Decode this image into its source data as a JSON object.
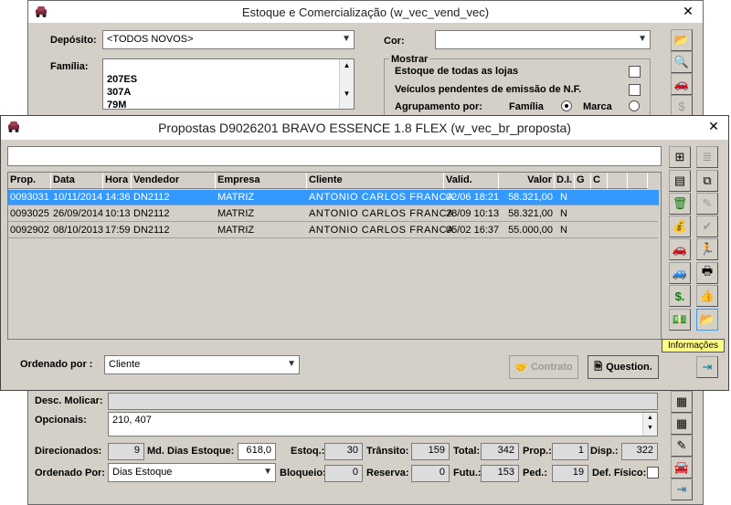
{
  "back_window": {
    "title": "Estoque e Comercialização (w_vec_vend_vec)",
    "deposito_label": "Depósito:",
    "deposito_value": "<TODOS NOVOS>",
    "cor_label": "Cor:",
    "cor_value": "",
    "familia_label": "Família:",
    "familia_items": [
      "207ES",
      "307A",
      "79M"
    ],
    "mostrar_label": "Mostrar",
    "estoque_lojas_label": "Estoque de todas as lojas",
    "veiculos_pendentes_label": "Veículos pendentes de emissão de N.F.",
    "agrupamento_label": "Agrupamento por:",
    "familia_radio_label": "Família",
    "marca_radio_label": "Marca",
    "desc_molicar_label": "Desc. Molicar:",
    "desc_molicar_value": "",
    "opcionais_label": "Opcionais:",
    "opcionais_value": "210, 407",
    "direcionados_label": "Direcionados:",
    "direcionados_value": "9",
    "md_dias_label": "Md. Dias Estoque:",
    "md_dias_value": "618,0",
    "estoq_label": "Estoq.:",
    "estoq_value": "30",
    "transito_label": "Trânsito:",
    "transito_value": "159",
    "total_label": "Total:",
    "total_value": "342",
    "prop_label": "Prop.:",
    "prop_value": "1",
    "disp_label": "Disp.:",
    "disp_value": "322",
    "ordenado_label": "Ordenado Por:",
    "ordenado_value": "Dias Estoque",
    "bloqueio_label": "Bloqueio:",
    "bloqueio_value": "0",
    "reserva_label": "Reserva:",
    "reserva_value": "0",
    "futu_label": "Futu.:",
    "futu_value": "153",
    "ped_label": "Ped.:",
    "ped_value": "19",
    "def_fisico_label": "Def. Físico:"
  },
  "front_window": {
    "title": "Propostas D9026201 BRAVO ESSENCE 1.8 FLEX (w_vec_br_proposta)",
    "search_value": "",
    "columns": [
      "Prop.",
      "Data",
      "Hora",
      "Vendedor",
      "Empresa",
      "Cliente",
      "Valid.",
      "Valor",
      "D.I.",
      "G",
      "C"
    ],
    "rows": [
      [
        "0093031",
        "10/11/2014",
        "14:36",
        "DN2112",
        "MATRIZ",
        "ANTONIO CARLOS FRANCA",
        "02/06 18:21",
        "58.321,00",
        "N",
        "",
        ""
      ],
      [
        "0093025",
        "26/09/2014",
        "10:13",
        "DN2112",
        "MATRIZ",
        "ANTONIO CARLOS FRANCA",
        "28/09 10:13",
        "58.321,00",
        "N",
        "",
        ""
      ],
      [
        "0092902",
        "08/10/2013",
        "17:59",
        "DN2112",
        "MATRIZ",
        "ANTONIO CARLOS FRANCA",
        "05/02 16:37",
        "55.000,00",
        "N",
        "",
        ""
      ]
    ],
    "ordenado_label": "Ordenado por :",
    "ordenado_value": "Cliente",
    "contrato_label": "Contrato",
    "question_label": "Question.",
    "tooltip": "Informações"
  },
  "colors": {
    "selection": "#3399ff",
    "window_bg": "#d4d0c8",
    "tooltip_bg": "#ffff88"
  }
}
